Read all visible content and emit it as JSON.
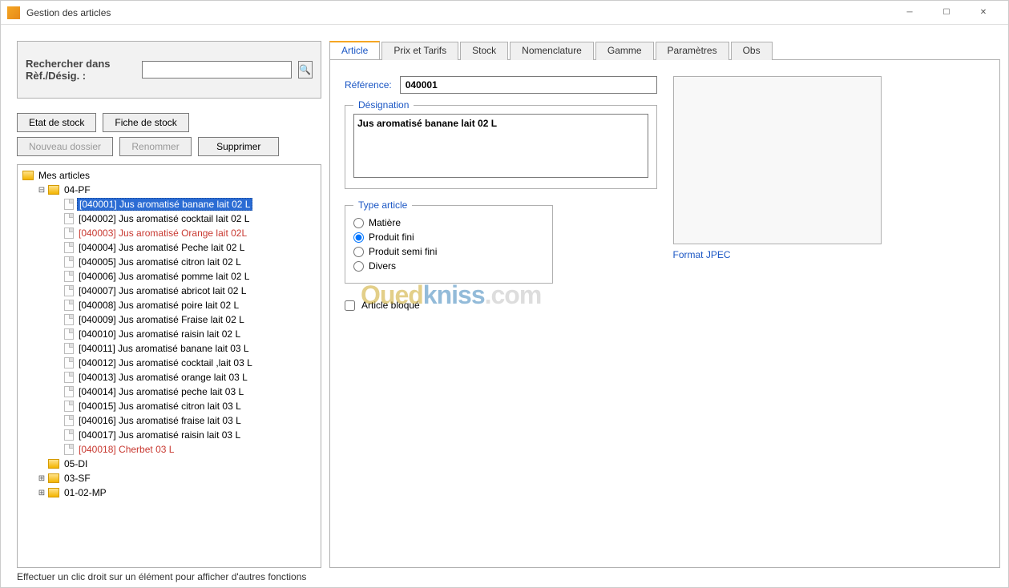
{
  "window": {
    "title": "Gestion des articles"
  },
  "search": {
    "label": "Rechercher dans Rèf./Désig. :",
    "value": ""
  },
  "buttons": {
    "etat_stock": "Etat de stock",
    "fiche_stock": "Fiche de stock",
    "nouveau_dossier": "Nouveau dossier",
    "renommer": "Renommer",
    "supprimer": "Supprimer"
  },
  "tree": {
    "root": "Mes articles",
    "folders": [
      {
        "name": "04-PF",
        "expanded": true,
        "items": [
          {
            "label": "[040001] Jus aromatisé banane lait 02 L",
            "selected": true
          },
          {
            "label": "[040002] Jus aromatisé cocktail lait 02 L"
          },
          {
            "label": "[040003] Jus aromatisé Orange lait 02L",
            "red": true
          },
          {
            "label": "[040004] Jus aromatisé Peche lait 02 L"
          },
          {
            "label": "[040005] Jus aromatisé citron lait 02 L"
          },
          {
            "label": "[040006] Jus aromatisé pomme lait 02 L"
          },
          {
            "label": "[040007] Jus aromatisé abricot lait 02 L"
          },
          {
            "label": "[040008] Jus aromatisé poire lait 02 L"
          },
          {
            "label": "[040009] Jus aromatisé Fraise lait 02 L"
          },
          {
            "label": "[040010] Jus aromatisé raisin lait 02 L"
          },
          {
            "label": "[040011] Jus aromatisé banane lait 03 L"
          },
          {
            "label": "[040012] Jus aromatisé cocktail ,lait 03 L"
          },
          {
            "label": "[040013] Jus aromatisé orange lait 03 L"
          },
          {
            "label": "[040014] Jus aromatisé peche lait 03 L"
          },
          {
            "label": "[040015] Jus aromatisé citron lait 03 L"
          },
          {
            "label": "[040016] Jus aromatisé fraise lait 03 L"
          },
          {
            "label": "[040017] Jus aromatisé raisin lait 03 L"
          },
          {
            "label": "[040018] Cherbet 03 L",
            "red": true
          }
        ]
      },
      {
        "name": "05-DI",
        "expanded": false
      },
      {
        "name": "03-SF",
        "expanded": false,
        "has_children": true
      },
      {
        "name": "01-02-MP",
        "expanded": false,
        "has_children": true
      }
    ]
  },
  "tabs": [
    "Article",
    "Prix et Tarifs",
    "Stock",
    "Nomenclature",
    "Gamme",
    "Paramètres",
    "Obs"
  ],
  "active_tab": 0,
  "form": {
    "reference_label": "Référence:",
    "reference_value": "040001",
    "designation_label": "Désignation",
    "designation_value": "Jus aromatisé banane lait 02 L",
    "type_article_label": "Type article",
    "type_options": [
      "Matière",
      "Produit fini",
      "Produit semi fini",
      "Divers"
    ],
    "type_selected": 1,
    "article_bloque": "Article bloqué",
    "article_bloque_checked": false,
    "image_caption": "Format JPEC"
  },
  "statusbar": "Effectuer un clic droit sur un élément pour afficher d'autres fonctions",
  "watermark": {
    "p1": "Oued",
    "p2": "kniss",
    "p3": ".com"
  }
}
